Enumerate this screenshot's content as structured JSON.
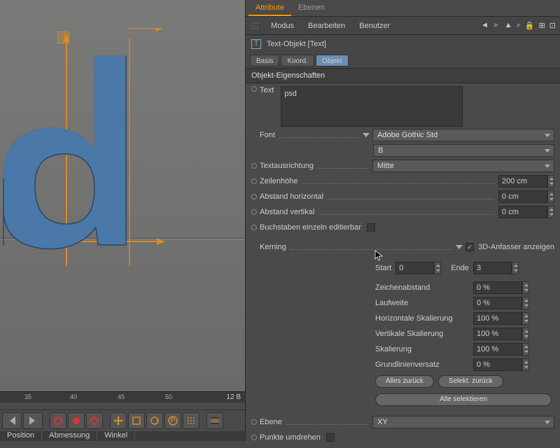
{
  "viewport": {
    "selection_char": "d"
  },
  "ruler": {
    "ticks": [
      35,
      40,
      45,
      50
    ],
    "frame_label": "12 B"
  },
  "statusbar": {
    "position": "Position",
    "size": "Abmessung",
    "angle": "Winkel"
  },
  "panel": {
    "tabs": [
      "Attribute",
      "Ebenen"
    ],
    "menus": [
      "Modus",
      "Bearbeiten",
      "Benutzer"
    ],
    "obj_title": "Text-Objekt [Text]",
    "subtabs": [
      "Basis",
      "Koord.",
      "Objekt"
    ],
    "section": "Objekt-Eigenschaften",
    "text_label": "Text",
    "text_value": "psd",
    "font_label": "Font",
    "font_value": "Adobe Gothic Std",
    "font_weight": "B",
    "align_label": "Textausrichtung",
    "align_value": "Mitte",
    "lineheight_label": "Zeilenhöhe",
    "lineheight_value": "200 cm",
    "hspace_label": "Abstand horizontal",
    "hspace_value": "0 cm",
    "vspace_label": "Abstand vertikal",
    "vspace_value": "0 cm",
    "editable_label": "Buchstaben einzeln editierbar",
    "kerning_label": "Kerning",
    "show3d_label": "3D-Anfasser anzeigen",
    "start_label": "Start",
    "start_value": "0",
    "end_label": "Ende",
    "end_value": "3",
    "tracking_label": "Zeichenabstand",
    "tracking_value": "0 %",
    "run_label": "Laufweite",
    "run_value": "0 %",
    "hscale_label": "Horizontale Skalierung",
    "hscale_value": "100 %",
    "vscale_label": "Vertikale Skalierung",
    "vscale_value": "100 %",
    "scale_label": "Skalierung",
    "scale_value": "100 %",
    "baseline_label": "Grundlinienversatz",
    "baseline_value": "0 %",
    "btn_reset_all": "Alles zurück",
    "btn_reset_sel": "Selekt. zurück",
    "btn_select_all": "Alle selektieren",
    "plane_label": "Ebene",
    "plane_value": "XY",
    "reverse_label": "Punkte umdrehen"
  }
}
